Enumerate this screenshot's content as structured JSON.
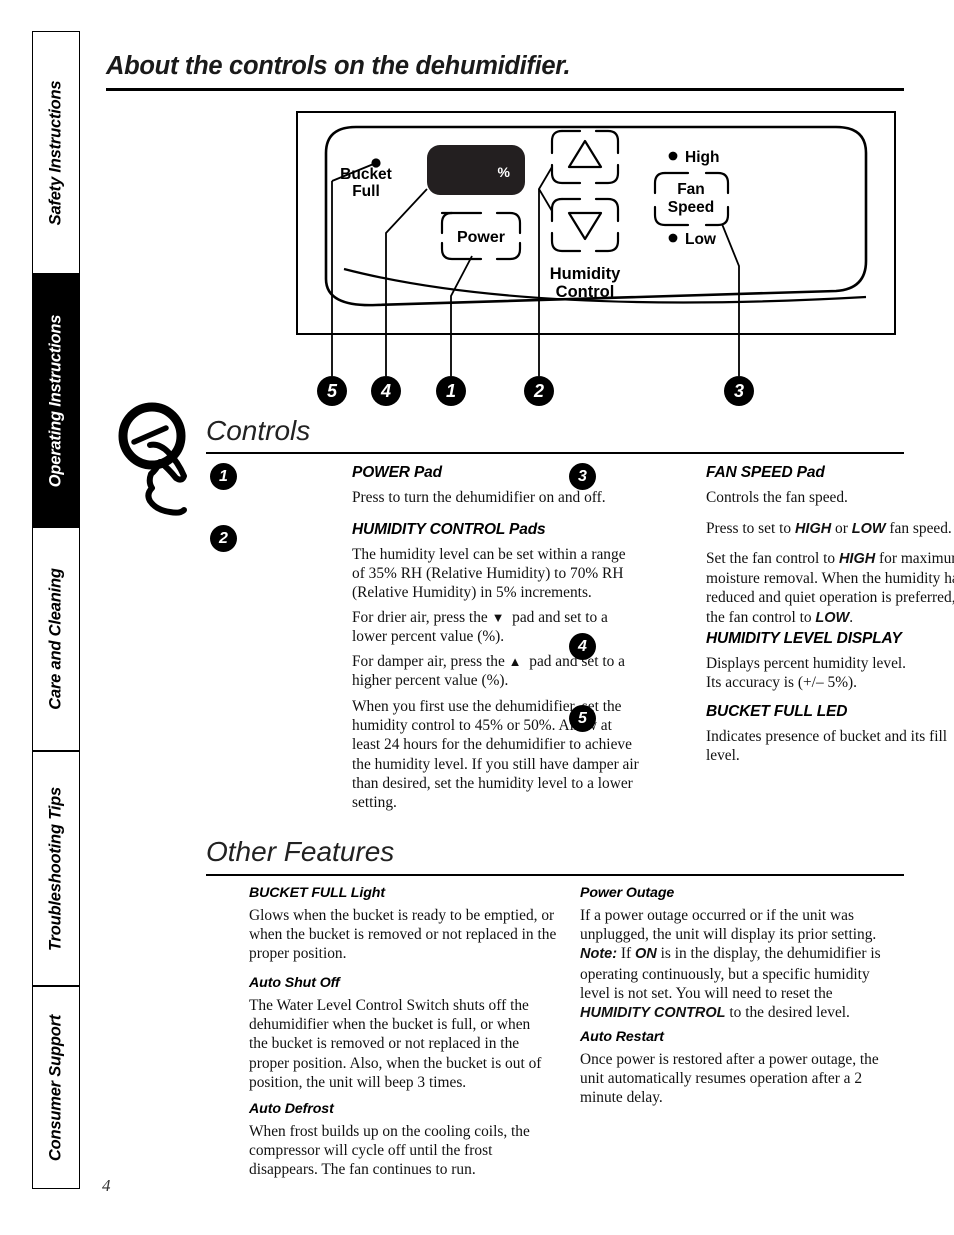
{
  "page_title": "About the controls on the dehumidifier.",
  "page_number": "4",
  "sidebar": {
    "tabs": [
      {
        "label": "Safety Instructions",
        "active": false
      },
      {
        "label": "Operating Instructions",
        "active": true
      },
      {
        "label": "Care and Cleaning",
        "active": false
      },
      {
        "label": "Troubleshooting Tips",
        "active": false
      },
      {
        "label": "Consumer Support",
        "active": false
      }
    ]
  },
  "control_panel": {
    "bucket_full_label": "Bucket\nFull",
    "bucket_full_line1": "Bucket",
    "bucket_full_line2": "Full",
    "display_symbol": "%",
    "power_label": "Power",
    "humidity_control_line1": "Humidity",
    "humidity_control_line2": "Control",
    "up_arrow": "up-triangle",
    "down_arrow": "down-triangle",
    "high_label": "High",
    "low_label": "Low",
    "fan_speed_line1": "Fan",
    "fan_speed_line2": "Speed",
    "callouts": [
      "5",
      "4",
      "1",
      "2",
      "3"
    ]
  },
  "controls_section": {
    "heading": "Controls",
    "items": [
      {
        "number": "1",
        "title": "POWER Pad",
        "paragraphs": [
          "Press to turn the dehumidifier on and off."
        ]
      },
      {
        "number": "2",
        "title": "HUMIDITY CONTROL Pads",
        "paragraphs": [
          "The humidity level can be set within a range of 35% RH (Relative Humidity) to 70% RH (Relative Humidity) in 5% increments.",
          "For drier air, press the ▼ pad and set to a lower percent value (%).",
          "For damper air, press the ▲ pad and set to a higher percent value (%).",
          "When you first use the dehumidifier, set the humidity control to 45% or 50%. Allow at least 24 hours for the dehumidifier to achieve the humidity level. If you still have damper air than desired, set the humidity level to a lower setting."
        ]
      },
      {
        "number": "3",
        "title": "FAN SPEED Pad",
        "paragraphs": [
          "Controls the fan speed.",
          "Press to set to HIGH or LOW fan speed.",
          "Set the fan control to HIGH for maximum moisture removal. When the humidity has been reduced and quiet operation is preferred, set the fan control to LOW."
        ]
      },
      {
        "number": "4",
        "title": "HUMIDITY LEVEL DISPLAY",
        "paragraphs": [
          "Displays percent humidity level.",
          "Its accuracy is (+/– 5%)."
        ]
      },
      {
        "number": "5",
        "title": "BUCKET FULL LED",
        "paragraphs": [
          "Indicates presence of bucket and its fill level."
        ]
      }
    ]
  },
  "other_features": {
    "heading": "Other Features",
    "left": [
      {
        "title": "BUCKET FULL Light",
        "body": "Glows when the bucket is ready to be emptied, or when the bucket is removed or not replaced in the proper position."
      },
      {
        "title": "Auto Shut Off",
        "body": "The Water Level Control Switch shuts off the dehumidifier when the bucket is full, or when the bucket is removed or not replaced in the proper position. Also, when the bucket is out of position, the unit will beep 3 times."
      },
      {
        "title": "Auto Defrost",
        "body": "When frost builds up on the cooling coils, the compressor will cycle off until the frost disappears. The fan continues to run."
      }
    ],
    "right": [
      {
        "title": "Power Outage",
        "body": "If a power outage occurred or if the unit was unplugged, the unit will display its prior setting. Note: If ON is in the display, the dehumidifier is operating continuously, but a specific humidity level is not set. You will need to reset the HUMIDITY CONTROL to the desired level."
      },
      {
        "title": "Auto Restart",
        "body": "Once power is restored after a power outage, the unit automatically resumes operation after a 2 minute delay."
      }
    ]
  }
}
